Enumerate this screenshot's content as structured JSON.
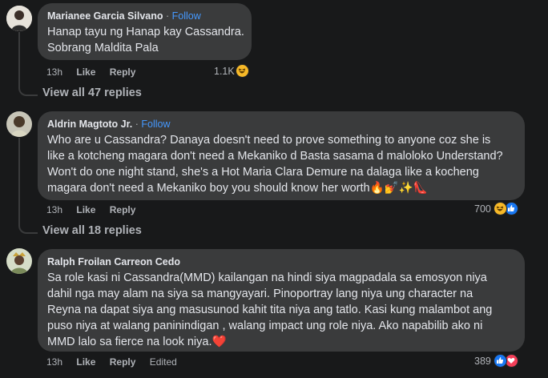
{
  "comments": [
    {
      "author": "Marianee Garcia Silvano",
      "follow": "Follow",
      "lines": [
        "Hanap tayu ng Hanap kay Cassandra.",
        "Sobrang Maldita Pala"
      ],
      "time": "13h",
      "like": "Like",
      "reply": "Reply",
      "reaction_count": "1.1K",
      "reactions": [
        "haha-icon"
      ],
      "view_replies": "View all 47 replies"
    },
    {
      "author": "Aldrin Magtoto Jr.",
      "follow": "Follow",
      "lines": [
        "Who are u Cassandra? Danaya doesn't need to prove something to anyone coz she is",
        "like a kotcheng magara don't need a Mekaniko d Basta sasama d maloloko Understand?",
        "Won't do one night stand, she's a Hot Maria Clara Demure na dalaga like a kocheng",
        "magara don't need a Mekaniko boy you should know her worth🔥💅✨👠"
      ],
      "time": "13h",
      "like": "Like",
      "reply": "Reply",
      "reaction_count": "700",
      "reactions": [
        "haha-icon",
        "like-icon"
      ],
      "view_replies": "View all 18 replies"
    },
    {
      "author": "Ralph Froilan Carreon Cedo",
      "lines": [
        "Sa role kasi ni Cassandra(MMD) kailangan na hindi siya magpadala sa emosyon niya",
        "dahil nga may alam na siya sa mangyayari. Pinoportray lang niya ung character na",
        "Reyna na dapat siya ang masusunod kahit tita niya ang tatlo. Kasi kung malambot ang",
        "puso niya at walang paninindigan , walang impact ung role niya. Ako napabilib ako ni",
        "MMD lalo sa fierce na look niya.❤️"
      ],
      "time": "13h",
      "like": "Like",
      "reply": "Reply",
      "edited": "Edited",
      "reaction_count": "389",
      "reactions": [
        "like-icon",
        "love-icon"
      ]
    }
  ],
  "colors": {
    "background": "#18191a",
    "bubble": "#3a3b3c",
    "follow": "#4599ff",
    "muted": "#b0b3b8",
    "like": "#1877f2",
    "love": "#f33e58",
    "haha": "#f7b928"
  }
}
